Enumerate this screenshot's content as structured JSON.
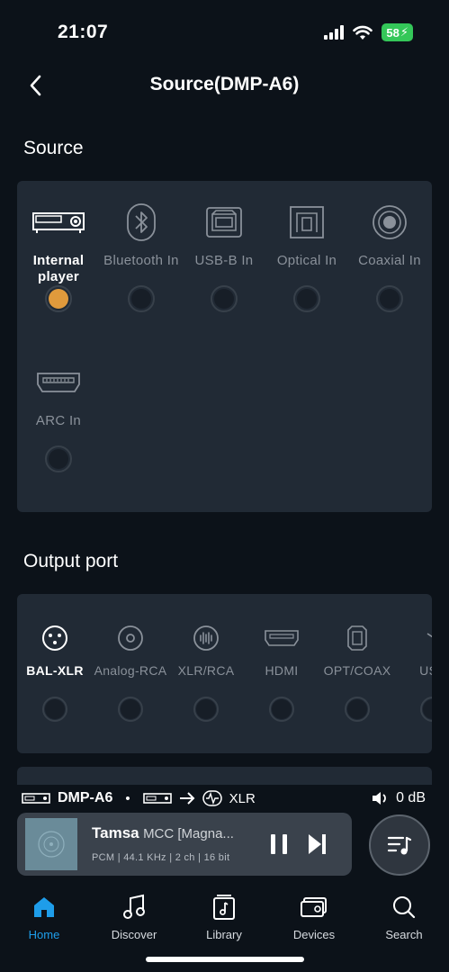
{
  "status": {
    "time": "21:07",
    "battery": "58"
  },
  "header": {
    "title": "Source(DMP-A6)"
  },
  "source": {
    "section_title": "Source",
    "selected": "internal-player",
    "items": [
      {
        "label": "Internal player",
        "icon": "projector-icon"
      },
      {
        "label": "Bluetooth In",
        "icon": "bluetooth-icon"
      },
      {
        "label": "USB-B In",
        "icon": "usb-b-icon"
      },
      {
        "label": "Optical In",
        "icon": "optical-icon"
      },
      {
        "label": "Coaxial In",
        "icon": "coaxial-icon"
      },
      {
        "label": "ARC In",
        "icon": "hdmi-arc-icon"
      }
    ]
  },
  "output": {
    "section_title": "Output port",
    "selected": "bal-xlr",
    "items": [
      {
        "label": "BAL-XLR",
        "icon": "xlr-icon"
      },
      {
        "label": "Analog-RCA",
        "icon": "rca-icon"
      },
      {
        "label": "XLR/RCA",
        "icon": "xlr-rca-icon"
      },
      {
        "label": "HDMI",
        "icon": "hdmi-icon"
      },
      {
        "label": "OPT/COAX",
        "icon": "opt-coax-icon"
      },
      {
        "label": "USB",
        "icon": "usb-icon"
      }
    ]
  },
  "route": {
    "device": "DMP-A6",
    "separator": "•",
    "output": "XLR",
    "volume": "0 dB"
  },
  "player": {
    "title": "Tamsa",
    "artist": "MCC [Magna...",
    "meta": "PCM | 44.1 KHz | 2 ch | 16 bit"
  },
  "tabs": [
    {
      "label": "Home",
      "icon": "home-icon",
      "active": true
    },
    {
      "label": "Discover",
      "icon": "music-note-icon"
    },
    {
      "label": "Library",
      "icon": "library-icon"
    },
    {
      "label": "Devices",
      "icon": "devices-icon"
    },
    {
      "label": "Search",
      "icon": "search-icon"
    }
  ],
  "colors": {
    "accent": "#1e9dea",
    "selected_radio": "#e09a3c",
    "card": "#212a35",
    "background": "#0c1219"
  }
}
